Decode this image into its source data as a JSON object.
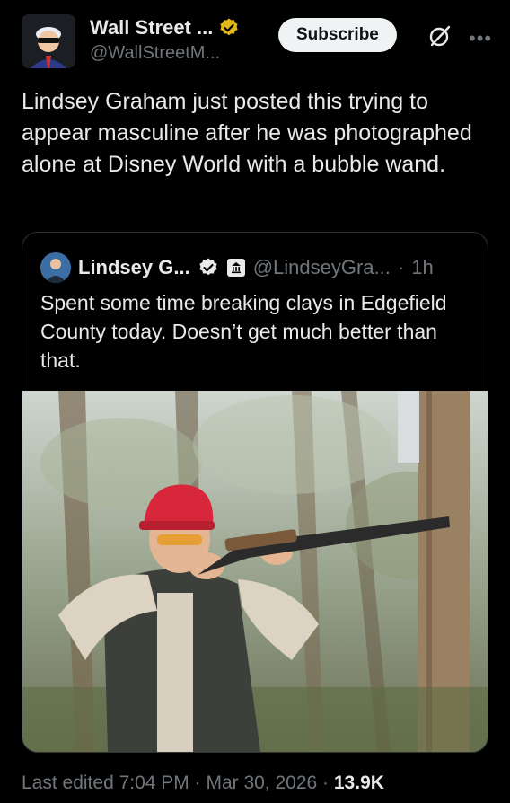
{
  "post": {
    "author_name": "Wall Street ...",
    "author_handle": "@WallStreetM...",
    "subscribe_label": "Subscribe",
    "text": "Lindsey Graham just posted this trying to appear masculine after he was photographed alone at Disney World with a bubble wand."
  },
  "quote": {
    "author_name": "Lindsey G...",
    "author_handle": "@LindseyGra...",
    "separator": "·",
    "time": "1h",
    "text": "Spent some time breaking clays in Edgefield County today. Doesn’t get much better than that."
  },
  "footer": {
    "edited": "Last edited 7:04 PM · Mar 30, 2026 ·",
    "views": "13.9K"
  },
  "icons": {
    "gold_badge": "gold-verified-badge",
    "grok": "grok-icon",
    "more": "more-icon",
    "verified": "verified-badge",
    "gov": "government-label-icon"
  },
  "colors": {
    "background": "#000000",
    "text_primary": "#e7e9ea",
    "text_secondary": "#71767b",
    "gold": "#e2b719",
    "verified_blue": "#ffffff",
    "cap_red": "#d8263a"
  }
}
